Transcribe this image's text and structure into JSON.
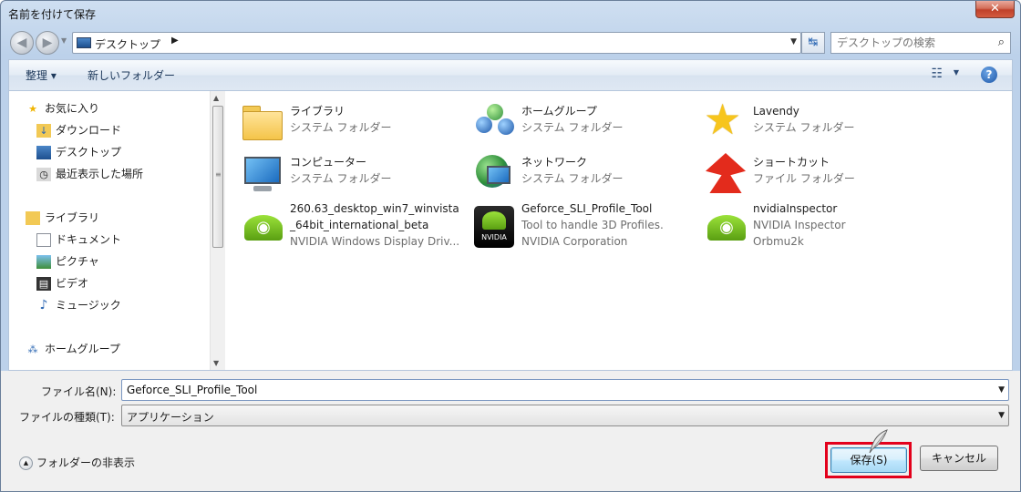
{
  "window": {
    "title": "名前を付けて保存",
    "close_label": "✕"
  },
  "nav": {
    "back_label": "◀",
    "forward_label": "▶",
    "address": "デスクトップ",
    "address_arrow": "▶",
    "refresh_label": "↹",
    "search_placeholder": "デスクトップの検索"
  },
  "toolbar": {
    "organize_label": "整理 ▾",
    "new_folder_label": "新しいフォルダー",
    "help_label": "?"
  },
  "sidebar": {
    "favorites_label": "お気に入り",
    "favorites": [
      "ダウンロード",
      "デスクトップ",
      "最近表示した場所"
    ],
    "libraries_label": "ライブラリ",
    "libraries": [
      "ドキュメント",
      "ピクチャ",
      "ビデオ",
      "ミュージック"
    ],
    "homegroup_label": "ホームグループ"
  },
  "files": [
    {
      "name": "ライブラリ",
      "sub1": "システム フォルダー",
      "sub2": "",
      "icon": "library-folder-icon"
    },
    {
      "name": "ホームグループ",
      "sub1": "システム フォルダー",
      "sub2": "",
      "icon": "homegroup-icon"
    },
    {
      "name": "Lavendy",
      "sub1": "システム フォルダー",
      "sub2": "",
      "icon": "star-icon"
    },
    {
      "name": "コンピューター",
      "sub1": "システム フォルダー",
      "sub2": "",
      "icon": "computer-icon"
    },
    {
      "name": "ネットワーク",
      "sub1": "システム フォルダー",
      "sub2": "",
      "icon": "network-icon"
    },
    {
      "name": "ショートカット",
      "sub1": "ファイル フォルダー",
      "sub2": "",
      "icon": "shortcut-icon"
    },
    {
      "name": "260.63_desktop_win7_winvista",
      "sub1": "_64bit_international_beta",
      "sub2": "NVIDIA Windows Display Driv...",
      "icon": "nvidia-icon"
    },
    {
      "name": "Geforce_SLI_Profile_Tool",
      "sub1": "Tool to handle 3D Profiles.",
      "sub2": "NVIDIA Corporation",
      "icon": "nvidia-box-icon"
    },
    {
      "name": "nvidiaInspector",
      "sub1": "NVIDIA Inspector",
      "sub2": "Orbmu2k",
      "icon": "nvidia-icon"
    }
  ],
  "form": {
    "filename_label": "ファイル名(N):",
    "filename_value": "Geforce_SLI_Profile_Tool",
    "filetype_label": "ファイルの種類(T):",
    "filetype_value": "アプリケーション",
    "hide_folders_label": "フォルダーの非表示",
    "save_label": "保存(S)",
    "cancel_label": "キャンセル"
  },
  "colors": {
    "highlight": "#e3001b",
    "accent": "#1d4f8e"
  }
}
